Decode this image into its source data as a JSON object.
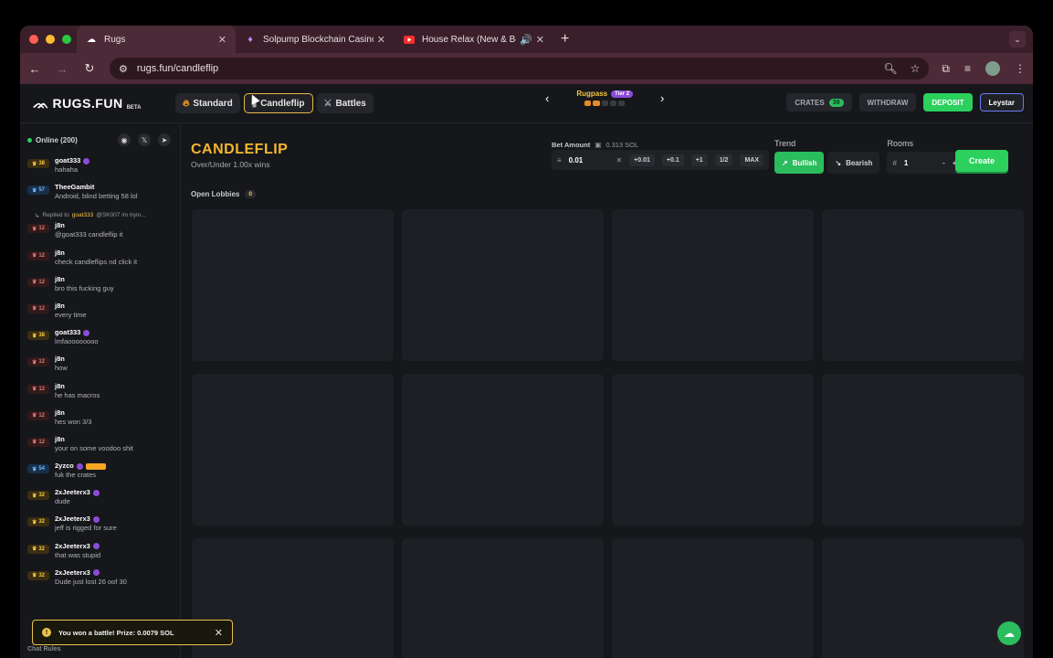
{
  "browser": {
    "tabs": [
      {
        "title": "Rugs",
        "icon": "rugs-favicon",
        "active": true
      },
      {
        "title": "Solpump Blockchain Casino |",
        "icon": "solpump-favicon",
        "active": false
      },
      {
        "title": "House Relax (New & Best",
        "icon": "youtube-favicon",
        "active": false
      }
    ],
    "url": "rugs.fun/candleflip"
  },
  "header": {
    "logo": "RUGS.FUN",
    "logo_badge": "BETA",
    "modes": [
      {
        "label": "Standard",
        "active": false
      },
      {
        "label": "Candleflip",
        "active": true
      },
      {
        "label": "Battles",
        "active": false
      }
    ],
    "rugpass_label": "Rugpass",
    "rugpass_tier": "Tier 2",
    "crates_label": "CRATES",
    "crates_count": "39",
    "withdraw_label": "WITHDRAW",
    "deposit_label": "DEPOSIT",
    "username": "Leystar"
  },
  "sidebar": {
    "online_label": "Online (200)",
    "chat_rules_label": "Chat Rules",
    "messages": [
      {
        "level": "38",
        "tier": "gold",
        "user": "goat333",
        "verified": true,
        "text": "hahaha"
      },
      {
        "level": "57",
        "tier": "blue",
        "user": "TheeGambit",
        "verified": false,
        "text": "Android, blind betting 58 lol"
      },
      {
        "level": "12",
        "tier": "red",
        "user": "j8n",
        "verified": false,
        "text": "@goat333 candleflip it"
      },
      {
        "level": "12",
        "tier": "red",
        "user": "j8n",
        "verified": false,
        "text": "check candleflips nd click it"
      },
      {
        "level": "12",
        "tier": "red",
        "user": "j8n",
        "verified": false,
        "text": "bro this fucking guy"
      },
      {
        "level": "12",
        "tier": "red",
        "user": "j8n",
        "verified": false,
        "text": "every time"
      },
      {
        "level": "38",
        "tier": "gold",
        "user": "goat333",
        "verified": true,
        "text": "lmfaoooooooo"
      },
      {
        "level": "12",
        "tier": "red",
        "user": "j8n",
        "verified": false,
        "text": "how"
      },
      {
        "level": "12",
        "tier": "red",
        "user": "j8n",
        "verified": false,
        "text": "he has macros"
      },
      {
        "level": "12",
        "tier": "red",
        "user": "j8n",
        "verified": false,
        "text": "hes won 3/3"
      },
      {
        "level": "12",
        "tier": "red",
        "user": "j8n",
        "verified": false,
        "text": "your on some voodoo shit"
      },
      {
        "level": "54",
        "tier": "blue",
        "user": "2yzco",
        "verified": true,
        "text": "fuk the crates"
      },
      {
        "level": "32",
        "tier": "gold",
        "user": "2xJeeterx3",
        "verified": true,
        "text": "dude"
      },
      {
        "level": "32",
        "tier": "gold",
        "user": "2xJeeterx3",
        "verified": true,
        "text": "jeff is rigged for sure"
      },
      {
        "level": "32",
        "tier": "gold",
        "user": "2xJeeterx3",
        "verified": true,
        "text": "that was stupid"
      },
      {
        "level": "32",
        "tier": "gold",
        "user": "2xJeeterx3",
        "verified": true,
        "text": "Dude just lost 26 oof 30"
      }
    ],
    "reply": {
      "prefix": "Replied to",
      "name": "goat333",
      "text": "@SK007 im tryin..."
    }
  },
  "toast": {
    "message": "You won a battle! Prize: 0.0079 SOL"
  },
  "game": {
    "title": "CANDLEFLIP",
    "subtitle": "Over/Under 1.00x wins",
    "bet_label": "Bet Amount",
    "balance": "0.313 SOL",
    "bet_value": "0.01",
    "bet_buttons": [
      "+0.01",
      "+0.1",
      "+1",
      "1/2",
      "MAX"
    ],
    "trend_label": "Trend",
    "bullish_label": "Bullish",
    "bearish_label": "Bearish",
    "rooms_label": "Rooms",
    "rooms_value": "1",
    "create_label": "Create",
    "open_lobbies_label": "Open Lobbies",
    "open_lobbies_count": "0"
  },
  "colors": {
    "accent_green": "#2bd05d",
    "title_gold": "#f5b82e",
    "background": "#16171b"
  }
}
